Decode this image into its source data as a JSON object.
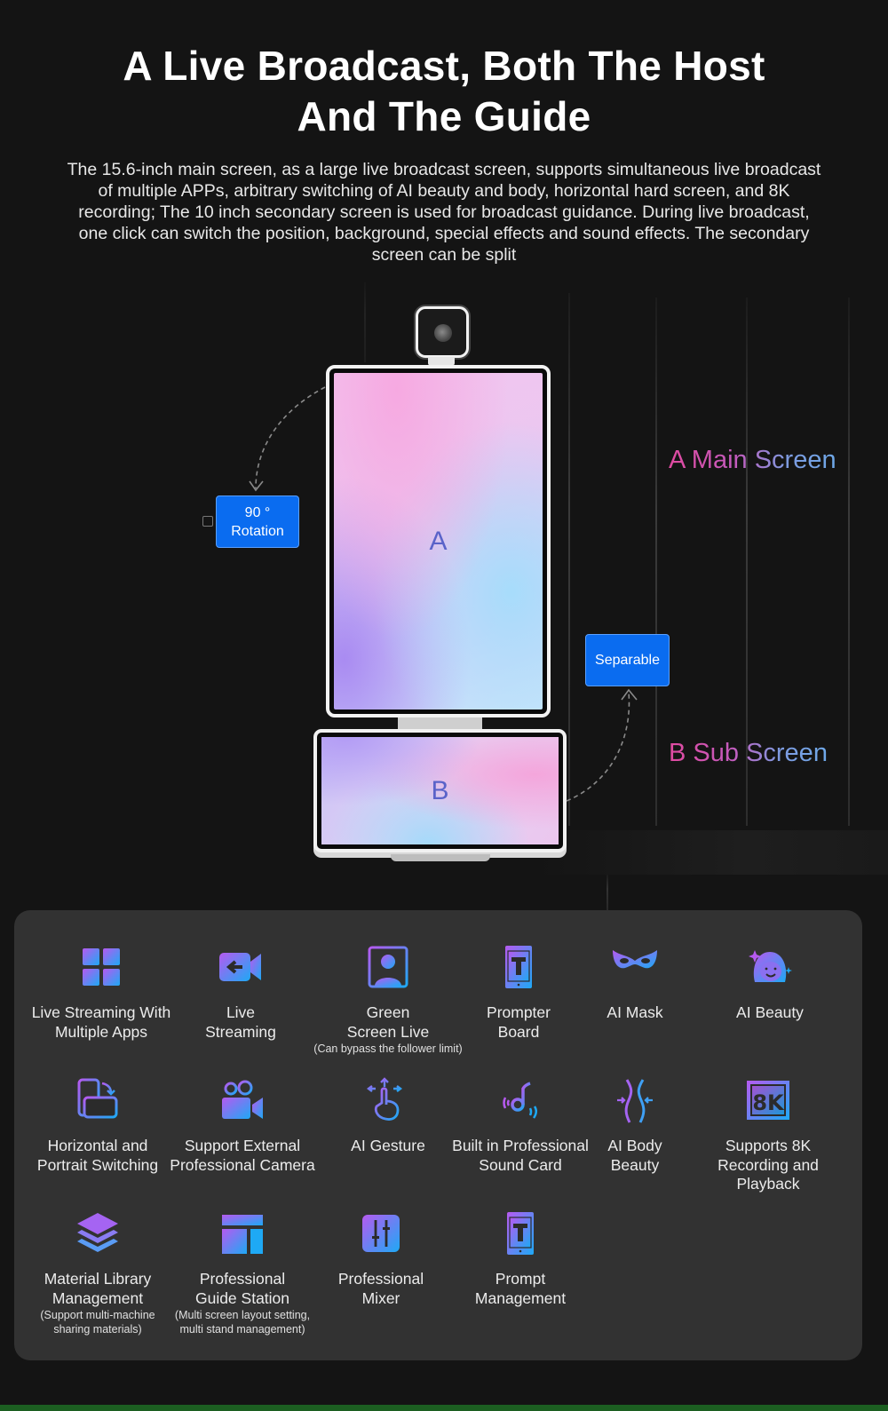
{
  "header": {
    "title_line1": "A Live Broadcast, Both The Host",
    "title_line2": "And The Guide",
    "description": "The 15.6-inch main screen, as a large live broadcast screen, supports simultaneous live broadcast of multiple APPs, arbitrary switching of AI beauty and body, horizontal hard screen, and 8K recording; The 10 inch secondary screen is used for broadcast guidance. During live broadcast, one click can switch the position, background, special effects and sound effects. The secondary screen can be split"
  },
  "hero": {
    "screen_a_letter": "A",
    "screen_b_letter": "B",
    "rotation_badge": {
      "line1": "90 °",
      "line2": "Rotation"
    },
    "separable_badge": "Separable",
    "label_a": "A Main Screen",
    "label_b": "B Sub Screen"
  },
  "colors": {
    "badge_blue": "#0a6cf0",
    "label_gradient_start": "#e04aa0",
    "label_gradient_end": "#6ea8e8",
    "icon_gradient_start": "#b05cf0",
    "icon_gradient_end": "#1ea8f5",
    "panel_bg": "#323232",
    "page_bg": "#141414"
  },
  "features": [
    {
      "icon": "grid-apps-icon",
      "label": "Live Streaming With\nMultiple Apps",
      "note": ""
    },
    {
      "icon": "video-camera-icon",
      "label": "Live\nStreaming",
      "note": ""
    },
    {
      "icon": "person-frame-icon",
      "label": "Green\nScreen Live",
      "note": "(Can bypass the follower limit)"
    },
    {
      "icon": "prompter-tablet-icon",
      "label": "Prompter\nBoard",
      "note": ""
    },
    {
      "icon": "mask-icon",
      "label": "AI Mask",
      "note": ""
    },
    {
      "icon": "beauty-face-icon",
      "label": "AI Beauty",
      "note": ""
    },
    {
      "icon": "rotate-screen-icon",
      "label": "Horizontal and\nPortrait Switching",
      "note": ""
    },
    {
      "icon": "movie-camera-icon",
      "label": "Support External\nProfessional Camera",
      "note": ""
    },
    {
      "icon": "gesture-hand-icon",
      "label": "AI Gesture",
      "note": ""
    },
    {
      "icon": "sound-note-icon",
      "label": "Built in Professional\nSound Card",
      "note": ""
    },
    {
      "icon": "body-slim-icon",
      "label": "AI Body\nBeauty",
      "note": ""
    },
    {
      "icon": "8k-icon",
      "label": "Supports 8K\nRecording and Playback",
      "note": ""
    },
    {
      "icon": "layers-icon",
      "label": "Material Library\nManagement",
      "note": "(Support multi-machine\nsharing materials)"
    },
    {
      "icon": "layout-icon",
      "label": "Professional\nGuide Station",
      "note": "(Multi screen layout setting,\nmulti stand management)"
    },
    {
      "icon": "mixer-sliders-icon",
      "label": "Professional\nMixer",
      "note": ""
    },
    {
      "icon": "prompt-tablet-icon",
      "label": "Prompt\nManagement",
      "note": ""
    }
  ]
}
